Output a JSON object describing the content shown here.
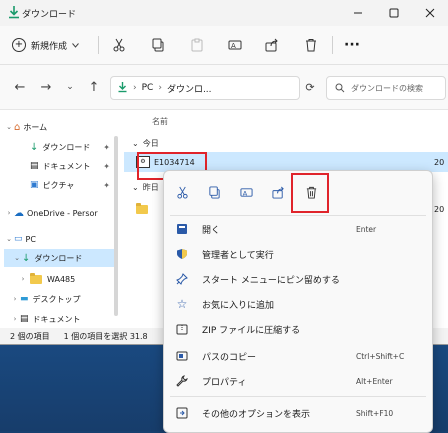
{
  "window": {
    "title": "ダウンロード"
  },
  "toolbar": {
    "new_label": "新規作成"
  },
  "address": {
    "pc": "PC",
    "current": "ダウンロ..."
  },
  "search": {
    "placeholder": "ダウンロードの検索"
  },
  "nav": {
    "items": [
      {
        "label": "ホーム"
      },
      {
        "label": "ダウンロード"
      },
      {
        "label": "ドキュメント"
      },
      {
        "label": "ピクチャ"
      },
      {
        "label": "OneDrive - Persor"
      },
      {
        "label": "PC"
      },
      {
        "label": "ダウンロード"
      },
      {
        "label": "WA485"
      },
      {
        "label": "デスクトップ"
      },
      {
        "label": "ドキュメント"
      }
    ]
  },
  "files": {
    "column_name": "名前",
    "group_today": "今日",
    "group_yesterday": "昨日",
    "selected_file": "E1034714",
    "date_prefix_1": "20",
    "date_prefix_2": "20"
  },
  "status": {
    "count": "2 個の項目",
    "selected": "1 個の項目を選択 31.8"
  },
  "context_menu": {
    "items": [
      {
        "label": "開く",
        "shortcut": "Enter",
        "icon": "open-icon"
      },
      {
        "label": "管理者として実行",
        "shortcut": "",
        "icon": "shield-icon"
      },
      {
        "label": "スタート メニューにピン留めする",
        "shortcut": "",
        "icon": "pin-icon"
      },
      {
        "label": "お気に入りに追加",
        "shortcut": "",
        "icon": "star-icon"
      },
      {
        "label": "ZIP ファイルに圧縮する",
        "shortcut": "",
        "icon": "zip-icon"
      },
      {
        "label": "パスのコピー",
        "shortcut": "Ctrl+Shift+C",
        "icon": "path-icon"
      },
      {
        "label": "プロパティ",
        "shortcut": "Alt+Enter",
        "icon": "wrench-icon"
      },
      {
        "label": "その他のオプションを表示",
        "shortcut": "Shift+F10",
        "icon": "more-options-icon"
      }
    ]
  },
  "colors": {
    "accent": "#0067c0",
    "highlight": "#e0242b",
    "selection": "#cce8ff"
  }
}
